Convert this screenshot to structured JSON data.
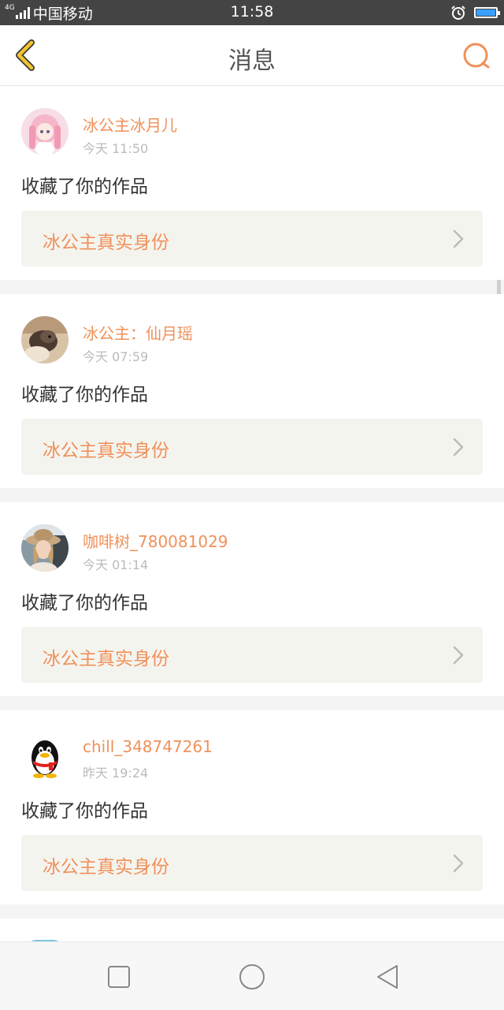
{
  "status_bar": {
    "network_type": "4G",
    "carrier": "中国移动",
    "time": "11:58",
    "alarm_icon": "alarm-clock-icon",
    "battery_icon": "battery-icon",
    "battery_color": "#3aa0ff"
  },
  "header": {
    "title": "消息",
    "back_icon": "chevron-left-icon",
    "search_icon": "search-icon",
    "accent_color": "#f0915a",
    "back_color": "#f2c230"
  },
  "messages": [
    {
      "username": "冰公主冰月儿",
      "time": "今天 11:50",
      "action": "收藏了你的作品",
      "work_title": "冰公主真实身份",
      "avatar": "anime-girl-avatar"
    },
    {
      "username": "冰公主：仙月瑶",
      "time": "今天 07:59",
      "action": "收藏了你的作品",
      "work_title": "冰公主真实身份",
      "avatar": "pet-photo-avatar"
    },
    {
      "username": "咖啡树_780081029",
      "time": "今天 01:14",
      "action": "收藏了你的作品",
      "work_title": "冰公主真实身份",
      "avatar": "woman-with-hat-avatar"
    },
    {
      "username": "chill_348747261",
      "time": "昨天 19:24",
      "action": "收藏了你的作品",
      "work_title": "冰公主真实身份",
      "avatar": "qq-penguin-avatar"
    }
  ],
  "nav_bar": {
    "recent_icon": "square-recent-apps-icon",
    "home_icon": "circle-home-icon",
    "back_icon": "triangle-back-icon"
  }
}
